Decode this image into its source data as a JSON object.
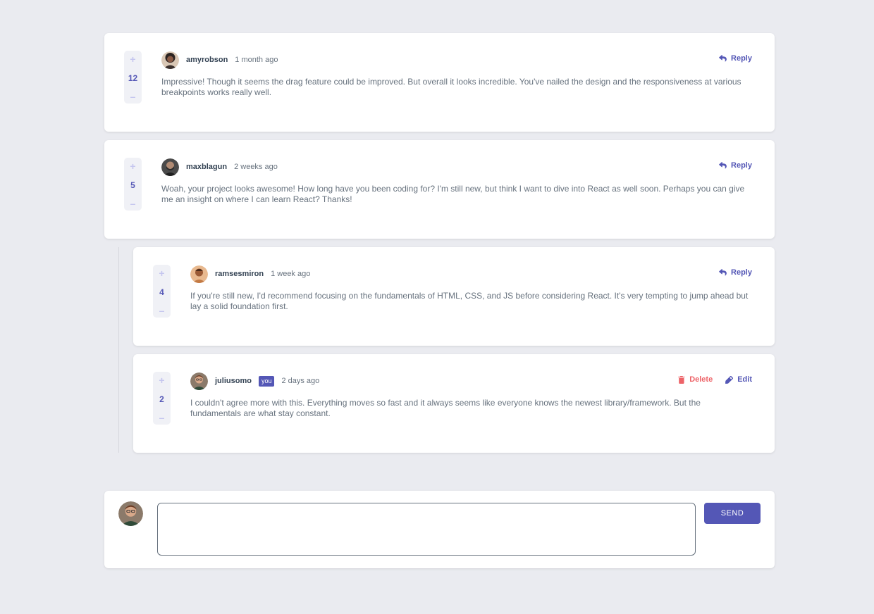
{
  "colors": {
    "background": "#eaebf0",
    "accent": "#5457b6",
    "accent_light": "#c5c6ef",
    "danger": "#ed6368",
    "text_dark": "#334253",
    "text_muted": "#67727e"
  },
  "comments": [
    {
      "username": "amyrobson",
      "time": "1 month ago",
      "score": "12",
      "text": "Impressive! Though it seems the drag feature could be improved. But overall it looks incredible. You've nailed the design and the responsiveness at various breakpoints works really well.",
      "reply_label": "Reply",
      "avatar_icon": "amyrobson-avatar"
    },
    {
      "username": "maxblagun",
      "time": "2 weeks ago",
      "score": "5",
      "text": "Woah, your project looks awesome! How long have you been coding for? I'm still new, but think I want to dive into React as well soon. Perhaps you can give me an insight on where I can learn React? Thanks!",
      "reply_label": "Reply",
      "avatar_icon": "maxblagun-avatar"
    }
  ],
  "replies": [
    {
      "username": "ramsesmiron",
      "time": "1 week ago",
      "score": "4",
      "text": "If you're still new, I'd recommend focusing on the fundamentals of HTML, CSS, and JS before considering React. It's very tempting to jump ahead but lay a solid foundation first.",
      "reply_label": "Reply",
      "avatar_icon": "ramsesmiron-avatar"
    },
    {
      "username": "juliusomo",
      "you_badge": "you",
      "time": "2 days ago",
      "score": "2",
      "text": "I couldn't agree more with this. Everything moves so fast and it always seems like everyone knows the newest library/framework. But the fundamentals are what stay constant.",
      "delete_label": "Delete",
      "edit_label": "Edit",
      "avatar_icon": "juliusomo-avatar"
    }
  ],
  "vote": {
    "plus": "+",
    "minus": "–"
  },
  "compose": {
    "placeholder": "",
    "send_label": "SEND",
    "avatar_icon": "current-user-avatar"
  }
}
